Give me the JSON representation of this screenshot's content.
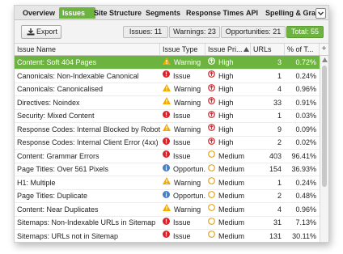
{
  "tabs": [
    "Overview",
    "Issues",
    "Site Structure",
    "Segments",
    "Response Times",
    "API",
    "Spelling & Gram"
  ],
  "active_tab": "Issues",
  "toolbar": {
    "export_label": "Export",
    "issues": "Issues: 11",
    "warnings": "Warnings: 23",
    "opportunities": "Opportunities: 21",
    "total": "Total: 55"
  },
  "columns": {
    "name": "Issue Name",
    "type": "Issue Type",
    "priority": "Issue Pri...",
    "urls": "URLs",
    "pct": "% of T..."
  },
  "rows": [
    {
      "name": "Content: Soft 404 Pages",
      "type": "Warning",
      "type_icon": "warning",
      "priority": "High",
      "priority_icon": "high",
      "urls": "3",
      "pct": "0.72%"
    },
    {
      "name": "Canonicals: Non-Indexable Canonical",
      "type": "Issue",
      "type_icon": "issue",
      "priority": "High",
      "priority_icon": "high",
      "urls": "1",
      "pct": "0.24%"
    },
    {
      "name": "Canonicals: Canonicalised",
      "type": "Warning",
      "type_icon": "warning",
      "priority": "High",
      "priority_icon": "high",
      "urls": "4",
      "pct": "0.96%"
    },
    {
      "name": "Directives: Noindex",
      "type": "Warning",
      "type_icon": "warning",
      "priority": "High",
      "priority_icon": "high",
      "urls": "33",
      "pct": "0.91%"
    },
    {
      "name": "Security: Mixed Content",
      "type": "Issue",
      "type_icon": "issue",
      "priority": "High",
      "priority_icon": "high",
      "urls": "1",
      "pct": "0.03%"
    },
    {
      "name": "Response Codes: Internal Blocked by Robots...",
      "type": "Warning",
      "type_icon": "warning",
      "priority": "High",
      "priority_icon": "high",
      "urls": "9",
      "pct": "0.09%"
    },
    {
      "name": "Response Codes: Internal Client Error (4xx)",
      "type": "Issue",
      "type_icon": "issue",
      "priority": "High",
      "priority_icon": "high",
      "urls": "2",
      "pct": "0.02%"
    },
    {
      "name": "Content: Grammar Errors",
      "type": "Issue",
      "type_icon": "issue",
      "priority": "Medium",
      "priority_icon": "medium",
      "urls": "403",
      "pct": "96.41%"
    },
    {
      "name": "Page Titles: Over 561 Pixels",
      "type": "Opportun...",
      "type_icon": "opportunity",
      "priority": "Medium",
      "priority_icon": "medium",
      "urls": "154",
      "pct": "36.93%"
    },
    {
      "name": "H1: Multiple",
      "type": "Warning",
      "type_icon": "warning",
      "priority": "Medium",
      "priority_icon": "medium",
      "urls": "1",
      "pct": "0.24%"
    },
    {
      "name": "Page Titles: Duplicate",
      "type": "Opportun...",
      "type_icon": "opportunity",
      "priority": "Medium",
      "priority_icon": "medium",
      "urls": "2",
      "pct": "0.48%"
    },
    {
      "name": "Content: Near Duplicates",
      "type": "Warning",
      "type_icon": "warning",
      "priority": "Medium",
      "priority_icon": "medium",
      "urls": "4",
      "pct": "0.96%"
    },
    {
      "name": "Sitemaps: Non-Indexable URLs in Sitemap",
      "type": "Issue",
      "type_icon": "issue",
      "priority": "Medium",
      "priority_icon": "medium",
      "urls": "31",
      "pct": "7.13%"
    },
    {
      "name": "Sitemaps: URLs not in Sitemap",
      "type": "Issue",
      "type_icon": "issue",
      "priority": "Medium",
      "priority_icon": "medium",
      "urls": "131",
      "pct": "30.11%"
    }
  ],
  "selected_row": 0,
  "colors": {
    "accent": "#6db33f",
    "issue": "#d9232a",
    "warning": "#f2a900",
    "opportunity": "#4a7ec2",
    "medium": "#e8a317"
  }
}
